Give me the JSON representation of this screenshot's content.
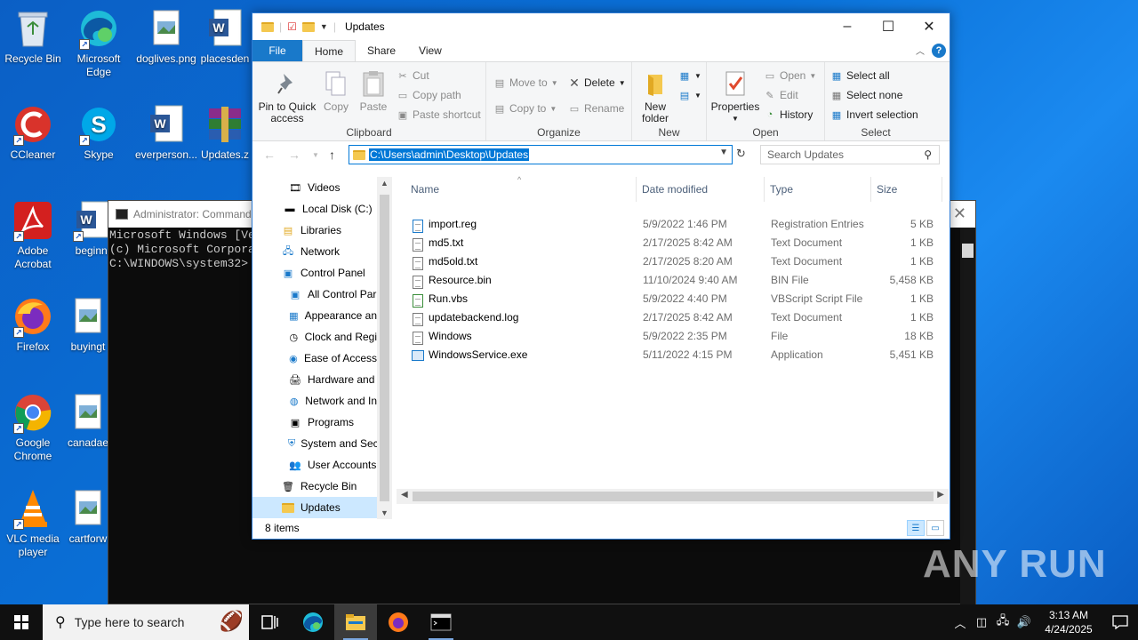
{
  "desktop": {
    "icons": [
      {
        "label": "Recycle Bin"
      },
      {
        "label": "Microsoft Edge"
      },
      {
        "label": "doglives.png"
      },
      {
        "label": "placesden"
      },
      {
        "label": "CCleaner"
      },
      {
        "label": "Skype"
      },
      {
        "label": "everperson..."
      },
      {
        "label": "Updates.z"
      },
      {
        "label": "Adobe Acrobat"
      },
      {
        "label": "beginni"
      },
      {
        "label": "Firefox"
      },
      {
        "label": "buyingt"
      },
      {
        "label": "Google Chrome"
      },
      {
        "label": "canadae"
      },
      {
        "label": "VLC media player"
      },
      {
        "label": "cartforw"
      }
    ]
  },
  "cmd": {
    "title": "Administrator: Command",
    "lines": [
      "Microsoft Windows [Ve",
      "(c) Microsoft Corpora",
      "",
      "C:\\WINDOWS\\system32>"
    ]
  },
  "explorer": {
    "title": "Updates",
    "tabs": {
      "file": "File",
      "home": "Home",
      "share": "Share",
      "view": "View"
    },
    "help": "?",
    "ribbon": {
      "clipboard": {
        "label": "Clipboard",
        "pin": "Pin to Quick access",
        "copy": "Copy",
        "paste": "Paste",
        "cut": "Cut",
        "copy_path": "Copy path",
        "paste_shortcut": "Paste shortcut"
      },
      "organize": {
        "label": "Organize",
        "move_to": "Move to",
        "copy_to": "Copy to",
        "delete": "Delete",
        "rename": "Rename"
      },
      "new": {
        "label": "New",
        "new_folder": "New folder"
      },
      "open": {
        "label": "Open",
        "properties": "Properties",
        "open": "Open",
        "edit": "Edit",
        "history": "History"
      },
      "select": {
        "label": "Select",
        "select_all": "Select all",
        "select_none": "Select none",
        "invert": "Invert selection"
      }
    },
    "address": "C:\\Users\\admin\\Desktop\\Updates",
    "search_placeholder": "Search Updates",
    "nav": [
      {
        "label": "Videos"
      },
      {
        "label": "Local Disk (C:)"
      },
      {
        "label": "Libraries"
      },
      {
        "label": "Network"
      },
      {
        "label": "Control Panel"
      },
      {
        "label": "All Control Par"
      },
      {
        "label": "Appearance an"
      },
      {
        "label": "Clock and Regi"
      },
      {
        "label": "Ease of Access"
      },
      {
        "label": "Hardware and"
      },
      {
        "label": "Network and In"
      },
      {
        "label": "Programs"
      },
      {
        "label": "System and Sec"
      },
      {
        "label": "User Accounts"
      },
      {
        "label": "Recycle Bin"
      },
      {
        "label": "Updates"
      }
    ],
    "columns": {
      "name": "Name",
      "date": "Date modified",
      "type": "Type",
      "size": "Size"
    },
    "files": [
      {
        "name": "import.reg",
        "date": "5/9/2022 1:46 PM",
        "type": "Registration Entries",
        "size": "5 KB",
        "icon": "reg-icon"
      },
      {
        "name": "md5.txt",
        "date": "2/17/2025 8:42 AM",
        "type": "Text Document",
        "size": "1 KB",
        "icon": "text-file-icon"
      },
      {
        "name": "md5old.txt",
        "date": "2/17/2025 8:20 AM",
        "type": "Text Document",
        "size": "1 KB",
        "icon": "text-file-icon"
      },
      {
        "name": "Resource.bin",
        "date": "11/10/2024 9:40 AM",
        "type": "BIN File",
        "size": "5,458 KB",
        "icon": "file-icon"
      },
      {
        "name": "Run.vbs",
        "date": "5/9/2022 4:40 PM",
        "type": "VBScript Script File",
        "size": "1 KB",
        "icon": "script-icon"
      },
      {
        "name": "updatebackend.log",
        "date": "2/17/2025 8:42 AM",
        "type": "Text Document",
        "size": "1 KB",
        "icon": "text-file-icon"
      },
      {
        "name": "Windows",
        "date": "5/9/2022 2:35 PM",
        "type": "File",
        "size": "18 KB",
        "icon": "file-icon"
      },
      {
        "name": "WindowsService.exe",
        "date": "5/11/2022 4:15 PM",
        "type": "Application",
        "size": "5,451 KB",
        "icon": "exe-icon"
      }
    ],
    "status": "8 items"
  },
  "watermark": "ANY RUN",
  "taskbar": {
    "search_placeholder": "Type here to search",
    "time": "3:13 AM",
    "date": "4/24/2025"
  }
}
